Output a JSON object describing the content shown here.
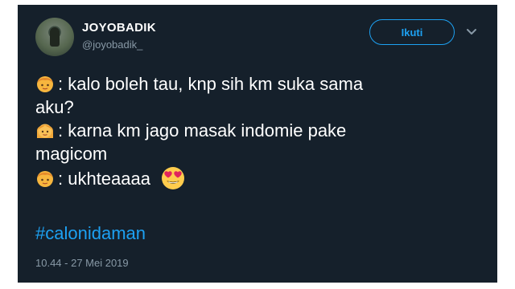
{
  "tweet": {
    "display_name": "JOYOBADIK",
    "handle": "@joyobadik_",
    "follow_label": "Ikuti",
    "lines": [
      ": kalo boleh tau, knp sih km suka sama",
      "aku?",
      ": karna km jago masak indomie pake",
      "magicom",
      ": ukhteaaaa"
    ],
    "hashtag": "#calonidaman",
    "timestamp": "10.44 - 27 Mei 2019"
  },
  "icons": {
    "boy": "boy-emoji-icon",
    "girl": "girl-emoji-icon",
    "heart_eyes": "heart-eyes-emoji-icon",
    "chevron": "chevron-down-icon"
  },
  "colors": {
    "background": "#15202b",
    "accent": "#1da1f2",
    "secondary_text": "#8899a6",
    "primary_text": "#ffffff"
  }
}
